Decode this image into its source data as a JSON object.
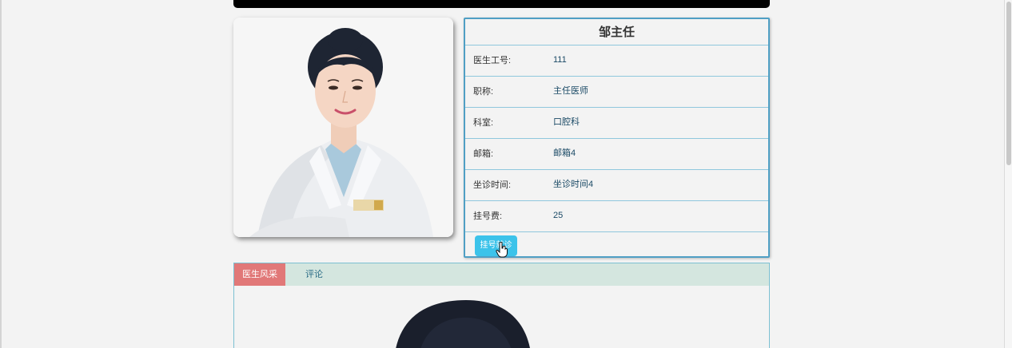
{
  "doctor": {
    "name": "邹主任",
    "fields": [
      {
        "label": "医生工号:",
        "value": "111"
      },
      {
        "label": "职称:",
        "value": "主任医师"
      },
      {
        "label": "科室:",
        "value": "口腔科"
      },
      {
        "label": "邮箱:",
        "value": "邮箱4"
      },
      {
        "label": "坐诊时间:",
        "value": "坐诊时间4"
      },
      {
        "label": "挂号费:",
        "value": "25"
      }
    ],
    "book_button_label": "挂号就诊"
  },
  "tabs": [
    {
      "label": "医生风采",
      "active": true
    },
    {
      "label": "评论",
      "active": false
    }
  ],
  "colors": {
    "accent_blue": "#3cc3ea",
    "card_border": "#4f9fc4",
    "tab_active": "#e17878",
    "tab_bar": "#d4e6df"
  },
  "icons": {
    "cursor": "hand-pointer-icon"
  }
}
